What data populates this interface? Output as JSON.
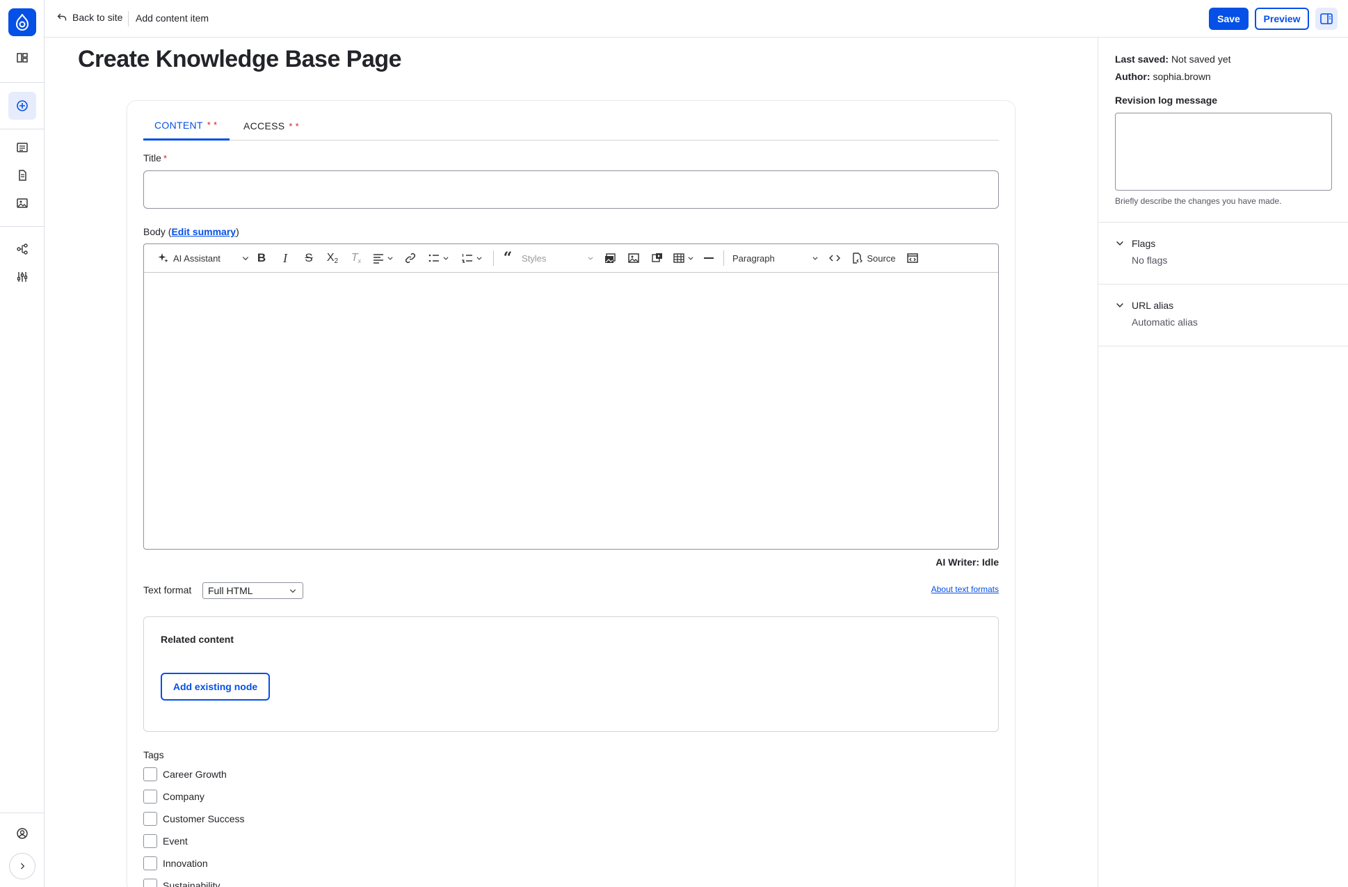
{
  "topbar": {
    "back_label": "Back to site",
    "breadcrumb": "Add content item",
    "save_label": "Save",
    "preview_label": "Preview"
  },
  "page": {
    "title": "Create Knowledge Base Page"
  },
  "tabs": [
    {
      "label": "CONTENT",
      "required_marks": "* *"
    },
    {
      "label": "ACCESS",
      "required_marks": "* *"
    }
  ],
  "form": {
    "title_label": "Title",
    "required_mark": "*",
    "title_value": "",
    "body_label_prefix": "Body (",
    "body_link": "Edit summary",
    "body_label_suffix": ")",
    "toolbar": {
      "ai_assistant": "AI Assistant",
      "styles": "Styles",
      "heading": "Paragraph",
      "source": "Source"
    },
    "ai_writer_status": "AI Writer: Idle",
    "text_format_label": "Text format",
    "text_format_value": "Full HTML",
    "about_formats": "About text formats",
    "related_label": "Related content",
    "add_node_label": "Add existing node",
    "tags_label": "Tags",
    "tags": [
      "Career Growth",
      "Company",
      "Customer Success",
      "Event",
      "Innovation",
      "Sustainability"
    ]
  },
  "sidebar": {
    "last_saved_label": "Last saved:",
    "last_saved_value": "Not saved yet",
    "author_label": "Author:",
    "author_value": "sophia.brown",
    "revision_label": "Revision log message",
    "revision_help": "Briefly describe the changes you have made.",
    "flags_title": "Flags",
    "flags_value": "No flags",
    "alias_title": "URL alias",
    "alias_value": "Automatic alias"
  },
  "colors": {
    "accent": "#0550e6",
    "required": "#d72222"
  }
}
